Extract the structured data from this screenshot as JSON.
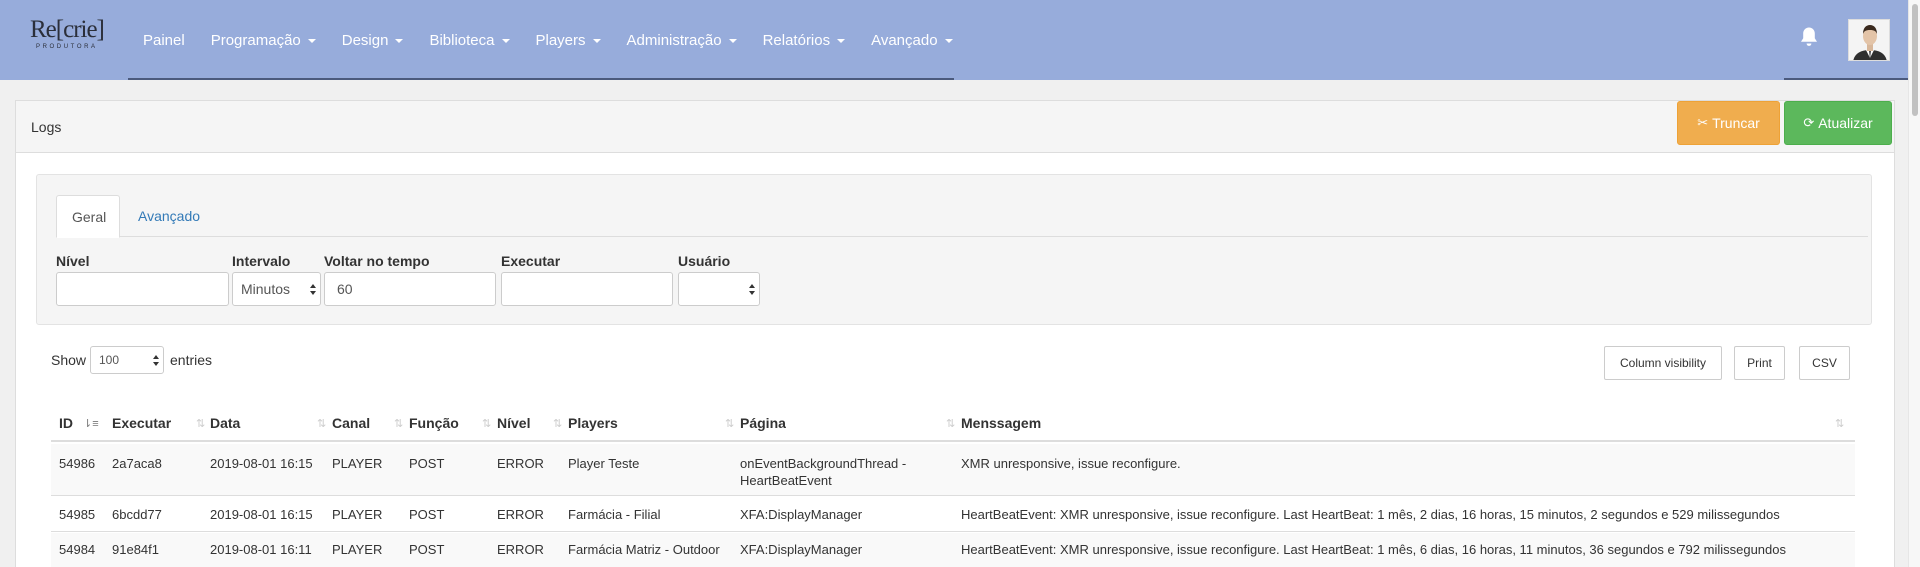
{
  "nav": {
    "logo_main": "Re[crie]",
    "logo_sub": "PRODUTORA",
    "items": [
      {
        "label": "Painel",
        "dropdown": false
      },
      {
        "label": "Programação",
        "dropdown": true
      },
      {
        "label": "Design",
        "dropdown": true
      },
      {
        "label": "Biblioteca",
        "dropdown": true
      },
      {
        "label": "Players",
        "dropdown": true
      },
      {
        "label": "Administração",
        "dropdown": true
      },
      {
        "label": "Relatórios",
        "dropdown": true
      },
      {
        "label": "Avançado",
        "dropdown": true
      }
    ],
    "bell_icon": "bell-icon",
    "avatar_icon": "user-avatar"
  },
  "panel": {
    "title": "Logs",
    "truncate_label": "Truncar",
    "refresh_label": "Atualizar"
  },
  "filters": {
    "tabs": [
      "Geral",
      "Avançado"
    ],
    "nivel_label": "Nível",
    "nivel_value": "",
    "intervalo_label": "Intervalo",
    "intervalo_value": "Minutos",
    "voltar_label": "Voltar no tempo",
    "voltar_value": "60",
    "executar_label": "Executar",
    "executar_value": "",
    "usuario_label": "Usuário",
    "usuario_value": ""
  },
  "table_controls": {
    "show_label": "Show",
    "entries_value": "100",
    "entries_label": "entries",
    "column_visibility": "Column visibility",
    "print": "Print",
    "csv": "CSV"
  },
  "table": {
    "columns": [
      "ID",
      "Executar",
      "Data",
      "Canal",
      "Função",
      "Nível",
      "Players",
      "Página",
      "Menssagem"
    ],
    "rows": [
      {
        "id": "54986",
        "executar": "2a7aca8",
        "data": "2019-08-01 16:15",
        "canal": "PLAYER",
        "funcao": "POST",
        "nivel": "ERROR",
        "players": "Player Teste",
        "pagina": "onEventBackgroundThread - HeartBeatEvent",
        "mensagem": "XMR unresponsive, issue reconfigure."
      },
      {
        "id": "54985",
        "executar": "6bcdd77",
        "data": "2019-08-01 16:15",
        "canal": "PLAYER",
        "funcao": "POST",
        "nivel": "ERROR",
        "players": "Farmácia - Filial",
        "pagina": "XFA:DisplayManager",
        "mensagem": "HeartBeatEvent: XMR unresponsive, issue reconfigure. Last HeartBeat: 1 mês, 2 dias, 16 horas, 15 minutos, 2 segundos e 529 milissegundos"
      },
      {
        "id": "54984",
        "executar": "91e84f1",
        "data": "2019-08-01 16:11",
        "canal": "PLAYER",
        "funcao": "POST",
        "nivel": "ERROR",
        "players": "Farmácia Matriz - Outdoor",
        "pagina": "XFA:DisplayManager",
        "mensagem": "HeartBeatEvent: XMR unresponsive, issue reconfigure. Last HeartBeat: 1 mês, 6 dias, 16 horas, 11 minutos, 36 segundos e 792 milissegundos"
      }
    ]
  }
}
